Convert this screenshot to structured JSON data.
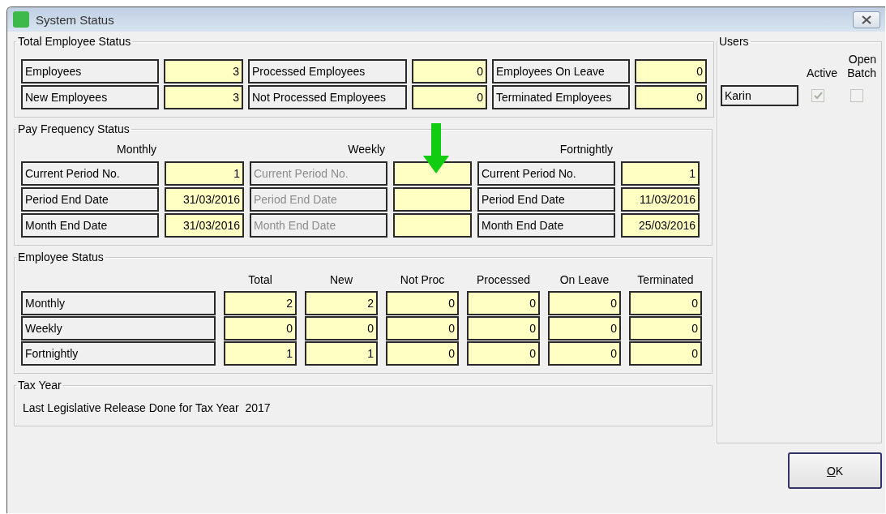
{
  "window": {
    "title": "System Status"
  },
  "total_employee_status": {
    "title": "Total Employee Status",
    "fields": [
      {
        "label": "Employees",
        "value": "3"
      },
      {
        "label": "Processed Employees",
        "value": "0"
      },
      {
        "label": "Employees On Leave",
        "value": "0"
      },
      {
        "label": "New Employees",
        "value": "3"
      },
      {
        "label": "Not Processed Employees",
        "value": "0"
      },
      {
        "label": "Terminated Employees",
        "value": "0"
      }
    ]
  },
  "pay_frequency_status": {
    "title": "Pay Frequency Status",
    "columns": [
      {
        "heading": "Monthly",
        "disabled": false,
        "fields": [
          {
            "label": "Current Period No.",
            "value": "1"
          },
          {
            "label": "Period End Date",
            "value": "31/03/2016"
          },
          {
            "label": "Month End Date",
            "value": "31/03/2016"
          }
        ]
      },
      {
        "heading": "Weekly",
        "disabled": true,
        "fields": [
          {
            "label": "Current Period No."
          },
          {
            "label": "Period End Date"
          },
          {
            "label": "Month End Date"
          }
        ]
      },
      {
        "heading": "Fortnightly",
        "disabled": false,
        "fields": [
          {
            "label": "Current Period No.",
            "value": "1"
          },
          {
            "label": "Period End Date",
            "value": "11/03/2016"
          },
          {
            "label": "Month End Date",
            "value": "25/03/2016"
          }
        ]
      }
    ]
  },
  "employee_status": {
    "title": "Employee Status",
    "columns": [
      "Total",
      "New",
      "Not Proc",
      "Processed",
      "On Leave",
      "Terminated"
    ],
    "rows": [
      {
        "label": "Monthly",
        "values": [
          "2",
          "2",
          "0",
          "0",
          "0",
          "0"
        ]
      },
      {
        "label": "Weekly",
        "values": [
          "0",
          "0",
          "0",
          "0",
          "0",
          "0"
        ]
      },
      {
        "label": "Fortnightly",
        "values": [
          "1",
          "1",
          "0",
          "0",
          "0",
          "0"
        ]
      }
    ]
  },
  "tax_year": {
    "title": "Tax Year",
    "text": "Last Legislative Release Done for Tax Year  2017"
  },
  "users": {
    "title": "Users",
    "columns": [
      "Active",
      "Open\nBatch"
    ],
    "rows": [
      {
        "name": "Karin",
        "active": true,
        "open_batch": false,
        "disabled": true
      }
    ]
  },
  "buttons": [
    {
      "label": "OK"
    }
  ]
}
